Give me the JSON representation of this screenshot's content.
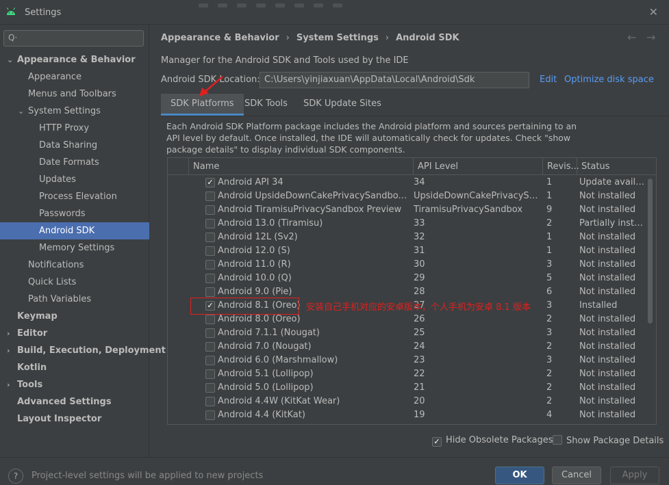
{
  "window": {
    "title": "Settings"
  },
  "sidebar": {
    "search_placeholder": "Q·",
    "items": [
      {
        "label": "Appearance & Behavior",
        "arrow": "v"
      },
      {
        "label": "Appearance"
      },
      {
        "label": "Menus and Toolbars"
      },
      {
        "label": "System Settings",
        "arrow": "v"
      },
      {
        "label": "HTTP Proxy"
      },
      {
        "label": "Data Sharing"
      },
      {
        "label": "Date Formats"
      },
      {
        "label": "Updates"
      },
      {
        "label": "Process Elevation"
      },
      {
        "label": "Passwords"
      },
      {
        "label": "Android SDK",
        "selected": true
      },
      {
        "label": "Memory Settings"
      },
      {
        "label": "Notifications"
      },
      {
        "label": "Quick Lists"
      },
      {
        "label": "Path Variables"
      },
      {
        "label": "Keymap"
      },
      {
        "label": "Editor",
        "arrow": ">"
      },
      {
        "label": "Build, Execution, Deployment",
        "arrow": ">"
      },
      {
        "label": "Kotlin"
      },
      {
        "label": "Tools",
        "arrow": ">"
      },
      {
        "label": "Advanced Settings"
      },
      {
        "label": "Layout Inspector"
      }
    ]
  },
  "breadcrumb": [
    "Appearance & Behavior",
    "System Settings",
    "Android SDK"
  ],
  "breadcrumb_sep": "›",
  "nav": {
    "back": "←",
    "forward": "→"
  },
  "main": {
    "description": "Manager for the Android SDK and Tools used by the IDE",
    "location_label": "Android SDK Location:",
    "location_value": "C:\\Users\\yinjiaxuan\\AppData\\Local\\Android\\Sdk",
    "edit_link": "Edit",
    "optimize_link": "Optimize disk space"
  },
  "tabs": [
    "SDK Platforms",
    "SDK Tools",
    "SDK Update Sites"
  ],
  "panel_description": "Each Android SDK Platform package includes the Android platform and sources pertaining to an API level by default. Once installed, the IDE will automatically check for updates. Check \"show package details\" to display individual SDK components.",
  "table": {
    "headers": [
      "Name",
      "API Level",
      "Revis...",
      "Status"
    ],
    "rows": [
      {
        "checked": true,
        "name": "Android API 34",
        "api": "34",
        "rev": "1",
        "status": "Update availa..."
      },
      {
        "checked": false,
        "name": "Android UpsideDownCakePrivacySandbox Previe",
        "api": "UpsideDownCakePrivacySand...",
        "rev": "1",
        "status": "Not installed"
      },
      {
        "checked": false,
        "name": "Android TiramisuPrivacySandbox Preview",
        "api": "TiramisuPrivacySandbox",
        "rev": "9",
        "status": "Not installed"
      },
      {
        "checked": false,
        "name": "Android 13.0 (Tiramisu)",
        "api": "33",
        "rev": "2",
        "status": "Partially install..."
      },
      {
        "checked": false,
        "name": "Android 12L (Sv2)",
        "api": "32",
        "rev": "1",
        "status": "Not installed"
      },
      {
        "checked": false,
        "name": "Android 12.0 (S)",
        "api": "31",
        "rev": "1",
        "status": "Not installed"
      },
      {
        "checked": false,
        "name": "Android 11.0 (R)",
        "api": "30",
        "rev": "3",
        "status": "Not installed"
      },
      {
        "checked": false,
        "name": "Android 10.0 (Q)",
        "api": "29",
        "rev": "5",
        "status": "Not installed"
      },
      {
        "checked": false,
        "name": "Android 9.0 (Pie)",
        "api": "28",
        "rev": "6",
        "status": "Not installed"
      },
      {
        "checked": true,
        "name": "Android 8.1 (Oreo)",
        "api": "27",
        "rev": "3",
        "status": "Installed"
      },
      {
        "checked": false,
        "name": "Android 8.0 (Oreo)",
        "api": "26",
        "rev": "2",
        "status": "Not installed"
      },
      {
        "checked": false,
        "name": "Android 7.1.1 (Nougat)",
        "api": "25",
        "rev": "3",
        "status": "Not installed"
      },
      {
        "checked": false,
        "name": "Android 7.0 (Nougat)",
        "api": "24",
        "rev": "2",
        "status": "Not installed"
      },
      {
        "checked": false,
        "name": "Android 6.0 (Marshmallow)",
        "api": "23",
        "rev": "3",
        "status": "Not installed"
      },
      {
        "checked": false,
        "name": "Android 5.1 (Lollipop)",
        "api": "22",
        "rev": "2",
        "status": "Not installed"
      },
      {
        "checked": false,
        "name": "Android 5.0 (Lollipop)",
        "api": "21",
        "rev": "2",
        "status": "Not installed"
      },
      {
        "checked": false,
        "name": "Android 4.4W (KitKat Wear)",
        "api": "20",
        "rev": "2",
        "status": "Not installed"
      },
      {
        "checked": false,
        "name": "Android 4.4 (KitKat)",
        "api": "19",
        "rev": "4",
        "status": "Not installed"
      }
    ]
  },
  "annotation": "安装自己手机对应的安卓版本，个人手机为安卓 8.1 版本",
  "options": {
    "hide_obsolete": "Hide Obsolete Packages",
    "show_details": "Show Package Details"
  },
  "footer": {
    "note": "Project-level settings will be applied to new projects",
    "help": "?",
    "ok": "OK",
    "cancel": "Cancel",
    "apply": "Apply"
  },
  "colors": {
    "accent": "#4b6eaf",
    "link": "#589df6",
    "annotation": "#e02020"
  }
}
